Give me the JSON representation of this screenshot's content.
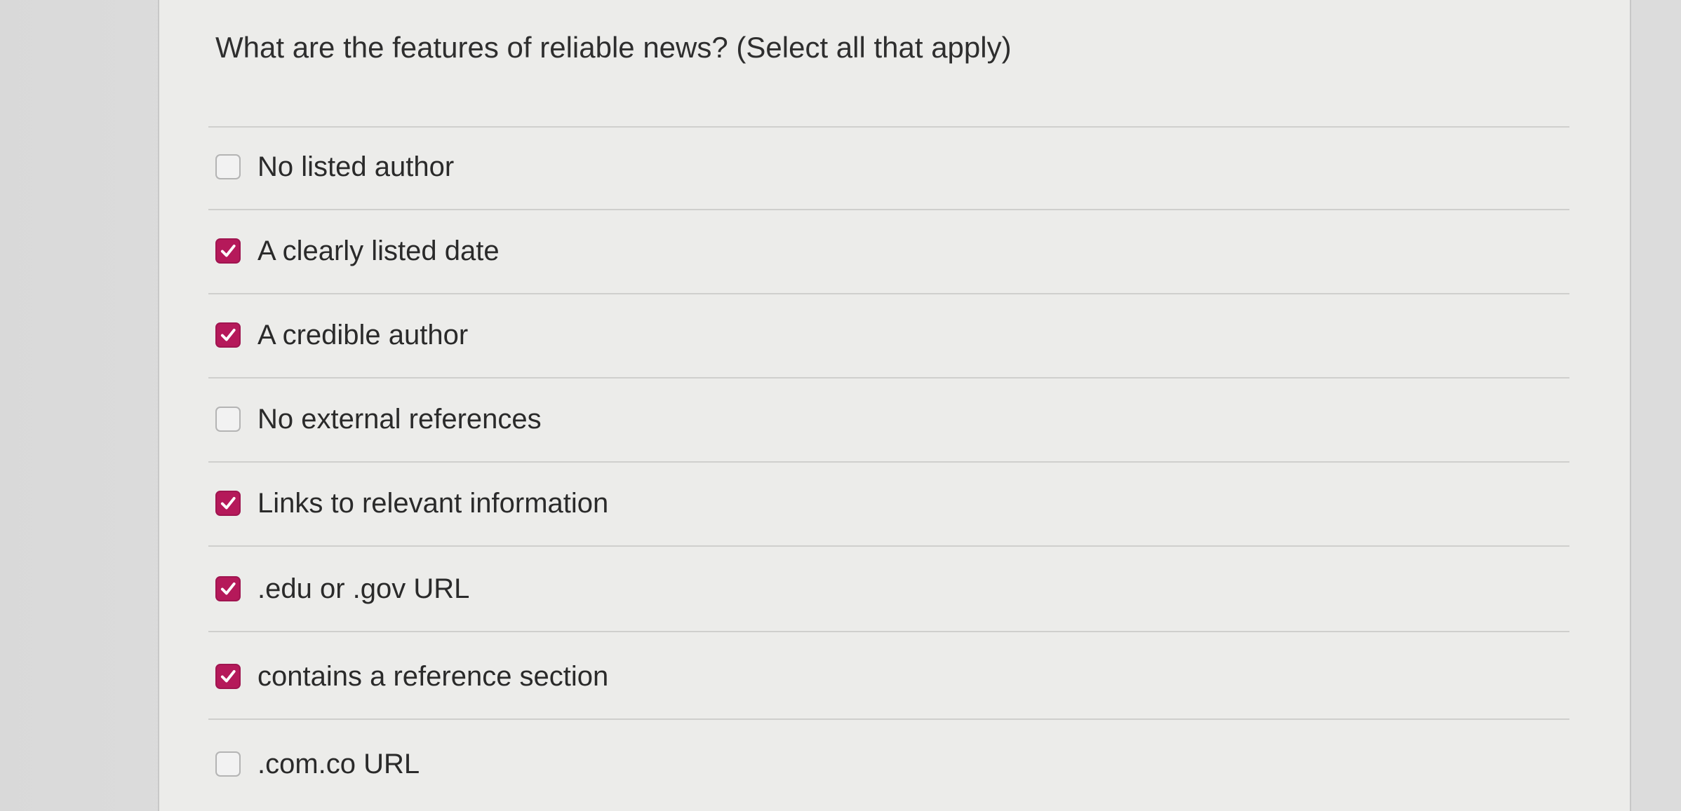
{
  "question": {
    "text": "What are the features of reliable news? (Select all that apply)"
  },
  "options": [
    {
      "label": "No listed author",
      "checked": false
    },
    {
      "label": "A clearly listed date",
      "checked": true
    },
    {
      "label": "A credible author",
      "checked": true
    },
    {
      "label": "No external references",
      "checked": false
    },
    {
      "label": "Links to relevant information",
      "checked": true
    },
    {
      "label": ".edu or .gov URL",
      "checked": true
    },
    {
      "label": "contains a reference section",
      "checked": true
    },
    {
      "label": ".com.co URL",
      "checked": false
    }
  ],
  "colors": {
    "checked_fill": "#b5195a",
    "checkmark": "#ffffff",
    "unchecked_border": "#b4b4b4"
  },
  "icons": {
    "checked": "checkmark-icon",
    "unchecked": "empty-checkbox-icon"
  }
}
